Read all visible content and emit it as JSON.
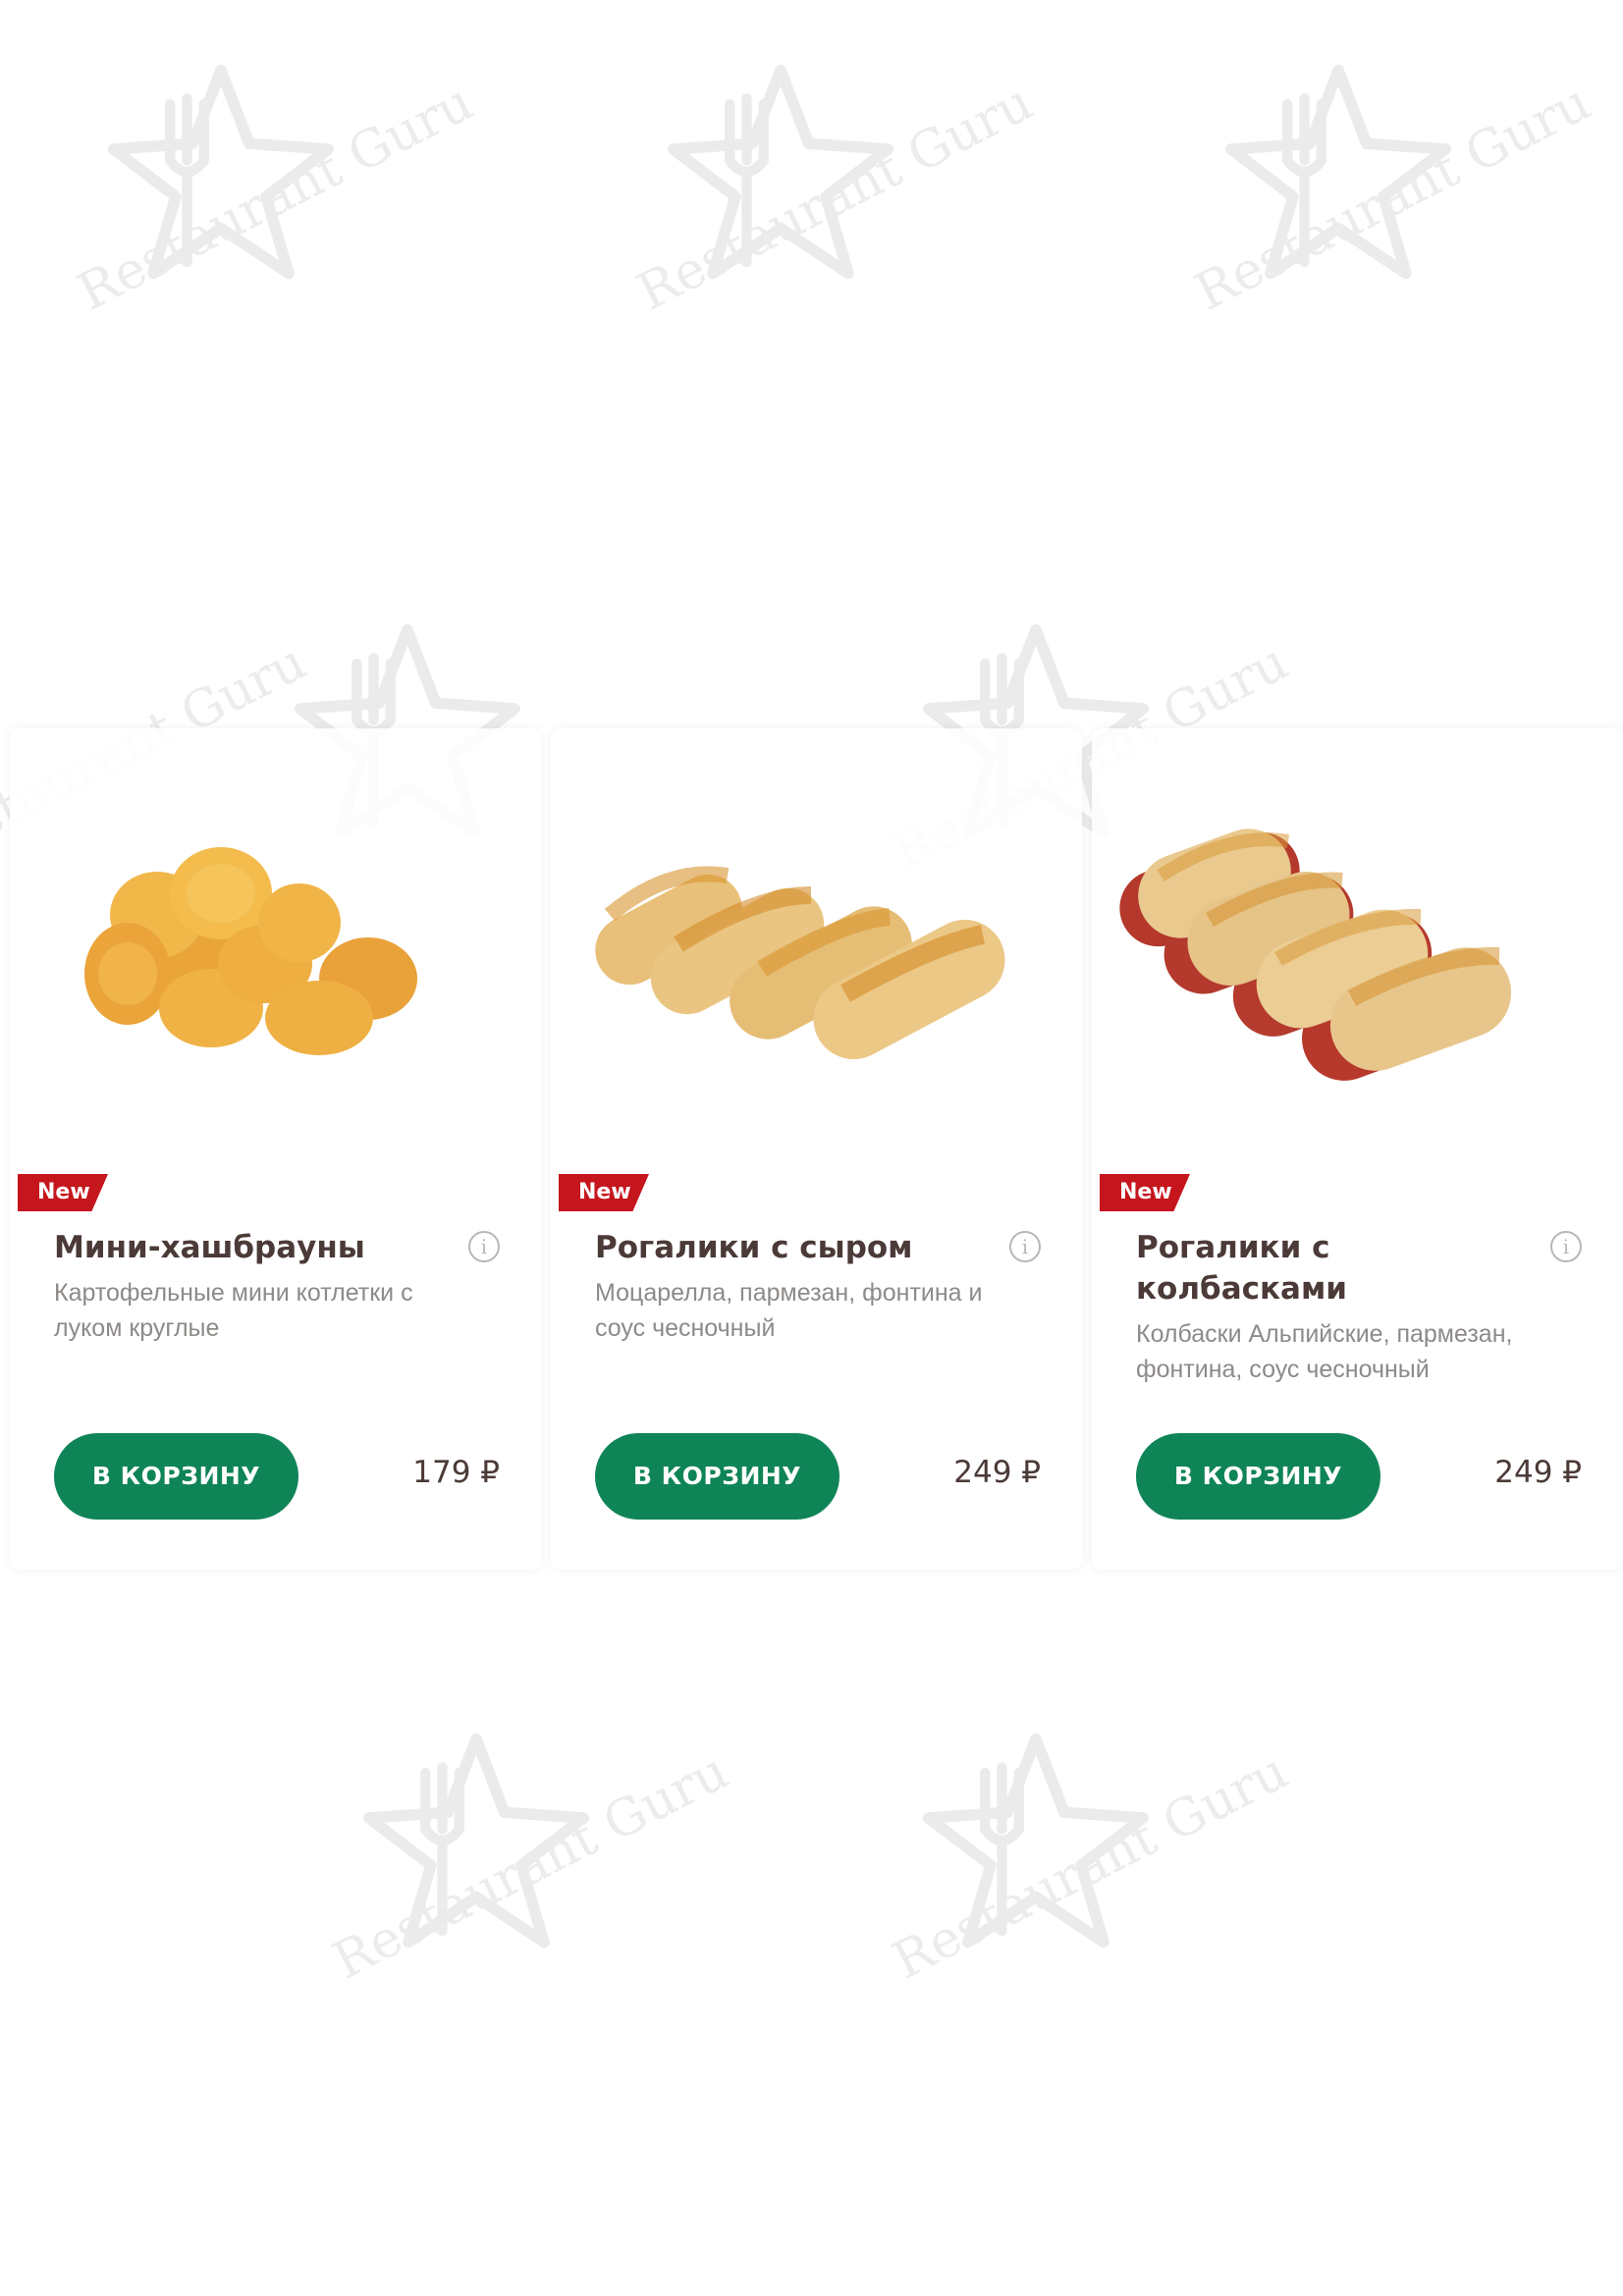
{
  "watermark": {
    "text": "Restaurant Guru",
    "icon": "restaurant-guru-star-fork-icon"
  },
  "colors": {
    "badge": "#c6161d",
    "button": "#0f8457",
    "title": "#4b3a37",
    "description": "#8d8a88"
  },
  "products": [
    {
      "badge": "New",
      "title": "Мини-хашбрауны",
      "description": "Картофельные мини котлетки с луком круглые",
      "button_label": "В КОРЗИНУ",
      "price": "179 ₽",
      "image": "hash-browns-image"
    },
    {
      "badge": "New",
      "title": "Рогалики с сыром",
      "description": "Моцарелла, пармезан, фонтина и соус чесночный",
      "button_label": "В КОРЗИНУ",
      "price": "249 ₽",
      "image": "cheese-rolls-image"
    },
    {
      "badge": "New",
      "title": "Рогалики с колбасками",
      "description": "Колбаски Альпийские, пармезан, фонтина, соус чесночный",
      "button_label": "В КОРЗИНУ",
      "price": "249 ₽",
      "image": "sausage-rolls-image"
    }
  ]
}
